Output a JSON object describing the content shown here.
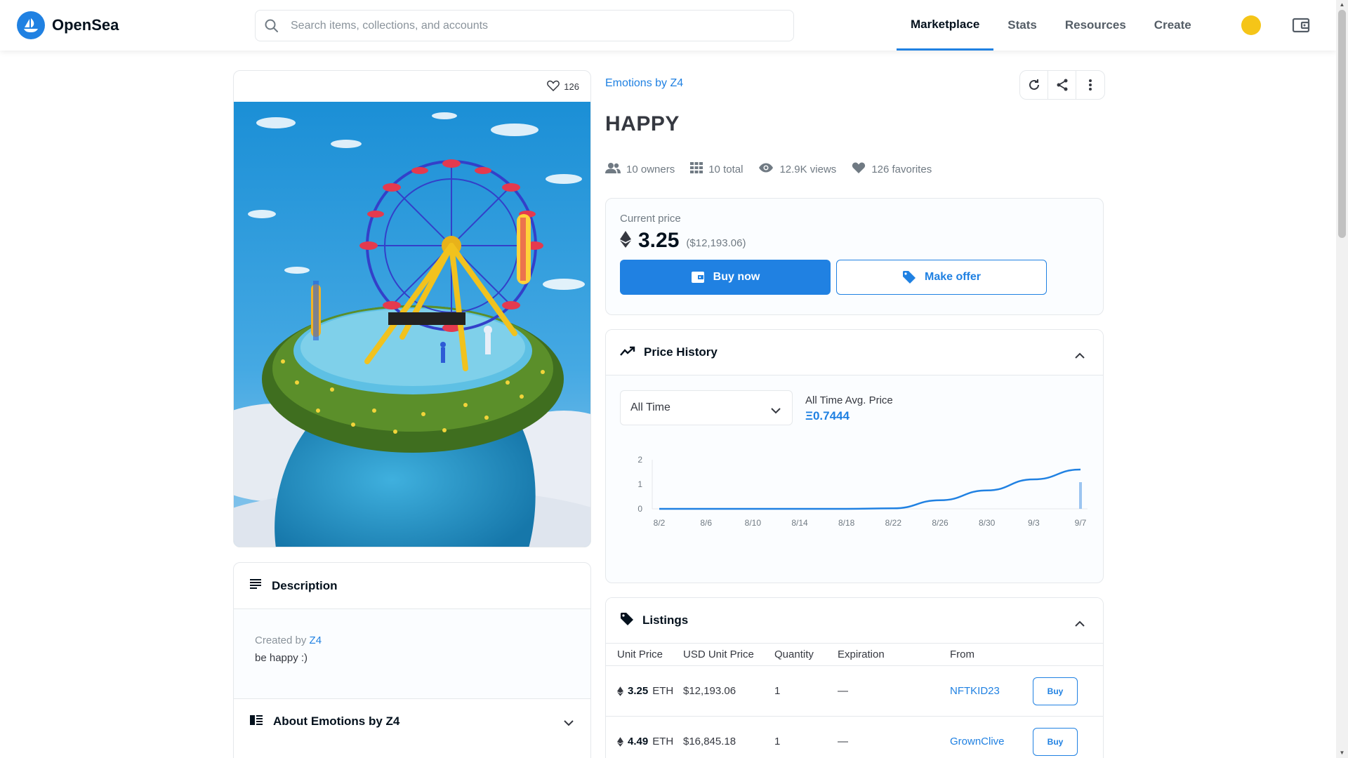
{
  "header": {
    "brand": "OpenSea",
    "search_placeholder": "Search items, collections, and accounts",
    "nav": [
      "Marketplace",
      "Stats",
      "Resources",
      "Create"
    ]
  },
  "item": {
    "favorites_count": "126",
    "collection": "Emotions by Z4",
    "title": "HAPPY",
    "stats": {
      "owners": "10 owners",
      "total": "10 total",
      "views": "12.9K views",
      "favorites": "126 favorites"
    }
  },
  "price": {
    "label": "Current price",
    "value": "3.25",
    "usd": "($12,193.06)",
    "buy_label": "Buy now",
    "offer_label": "Make offer"
  },
  "description": {
    "heading": "Description",
    "created_by_prefix": "Created by",
    "creator": "Z4",
    "text": "be happy :)",
    "about_heading": "About Emotions by Z4"
  },
  "price_history": {
    "heading": "Price History",
    "range": "All Time",
    "avg_label": "All Time Avg. Price",
    "avg_value": "Ξ0.7444"
  },
  "chart_data": {
    "type": "line",
    "x": [
      "8/2",
      "8/6",
      "8/10",
      "8/14",
      "8/18",
      "8/22",
      "8/26",
      "8/30",
      "9/3",
      "9/7"
    ],
    "y": [
      0,
      0,
      0,
      0,
      0,
      0.02,
      0.35,
      0.75,
      1.2,
      1.6
    ],
    "yticks": [
      "2",
      "1",
      "0"
    ],
    "ylim": [
      0,
      2
    ],
    "title": "",
    "xlabel": "",
    "ylabel": ""
  },
  "listings": {
    "heading": "Listings",
    "columns": [
      "Unit Price",
      "USD Unit Price",
      "Quantity",
      "Expiration",
      "From"
    ],
    "rows": [
      {
        "price": "3.25",
        "unit": "ETH",
        "usd": "$12,193.06",
        "qty": "1",
        "exp": "—",
        "from": "NFTKID23",
        "action": "Buy"
      },
      {
        "price": "4.49",
        "unit": "ETH",
        "usd": "$16,845.18",
        "qty": "1",
        "exp": "—",
        "from": "GrownClive",
        "action": "Buy"
      }
    ]
  },
  "colors": {
    "accent": "#2081e2",
    "text": "#04111d",
    "muted": "#707a83"
  }
}
